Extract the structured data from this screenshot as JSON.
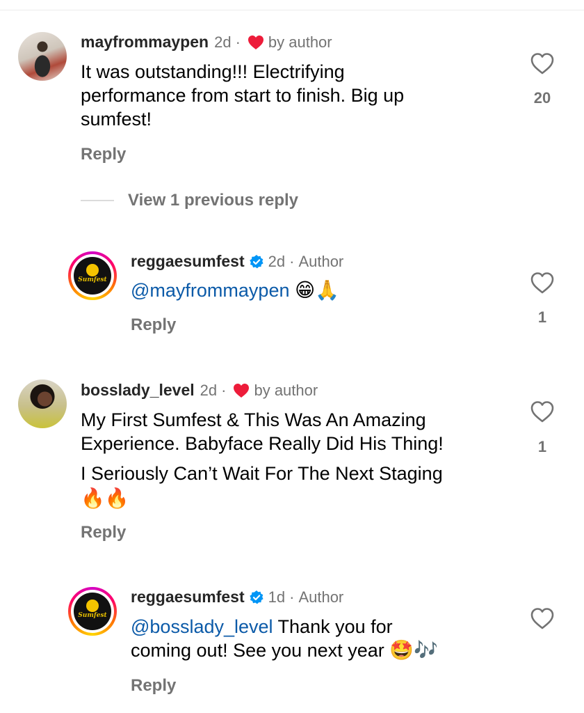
{
  "comments": [
    {
      "username": "mayfrommaypen",
      "time": "2d",
      "author_like_label": "by author",
      "text_lines": [
        "It was outstanding!!! Electrifying",
        "performance from start to finish. Big up",
        "sumfest!"
      ],
      "reply_label": "Reply",
      "likes": "20",
      "view_replies_label": "View 1 previous reply",
      "reply_item": {
        "username": "reggaesumfest",
        "time": "2d",
        "role": "Author",
        "mention": "@mayfrommaypen",
        "emojis": "😁🙏",
        "reply_label": "Reply",
        "likes": "1",
        "logo_text": "Sumfest"
      }
    },
    {
      "username": "bosslady_level",
      "time": "2d",
      "author_like_label": "by author",
      "text_lines": [
        "My First Sumfest & This Was An Amazing",
        "Experience. Babyface Really Did His Thing!",
        "I Seriously Can’t Wait For The Next Staging"
      ],
      "emojis": "🔥🔥",
      "reply_label": "Reply",
      "likes": "1",
      "reply_item": {
        "username": "reggaesumfest",
        "time": "1d",
        "role": "Author",
        "mention": "@bosslady_level",
        "text_after_mention": " Thank you for",
        "text_line2": "coming out! See you next year ",
        "emojis": "🤩🎶",
        "reply_label": "Reply",
        "logo_text": "Sumfest"
      }
    }
  ],
  "colors": {
    "author_heart": "#ed1c3a",
    "verified": "#0095f6",
    "mention": "#0b5aa8",
    "muted": "#737373"
  },
  "icons": {
    "like": "heart-outline-icon",
    "author_like": "heart-filled-icon",
    "verified": "verified-badge-icon"
  }
}
